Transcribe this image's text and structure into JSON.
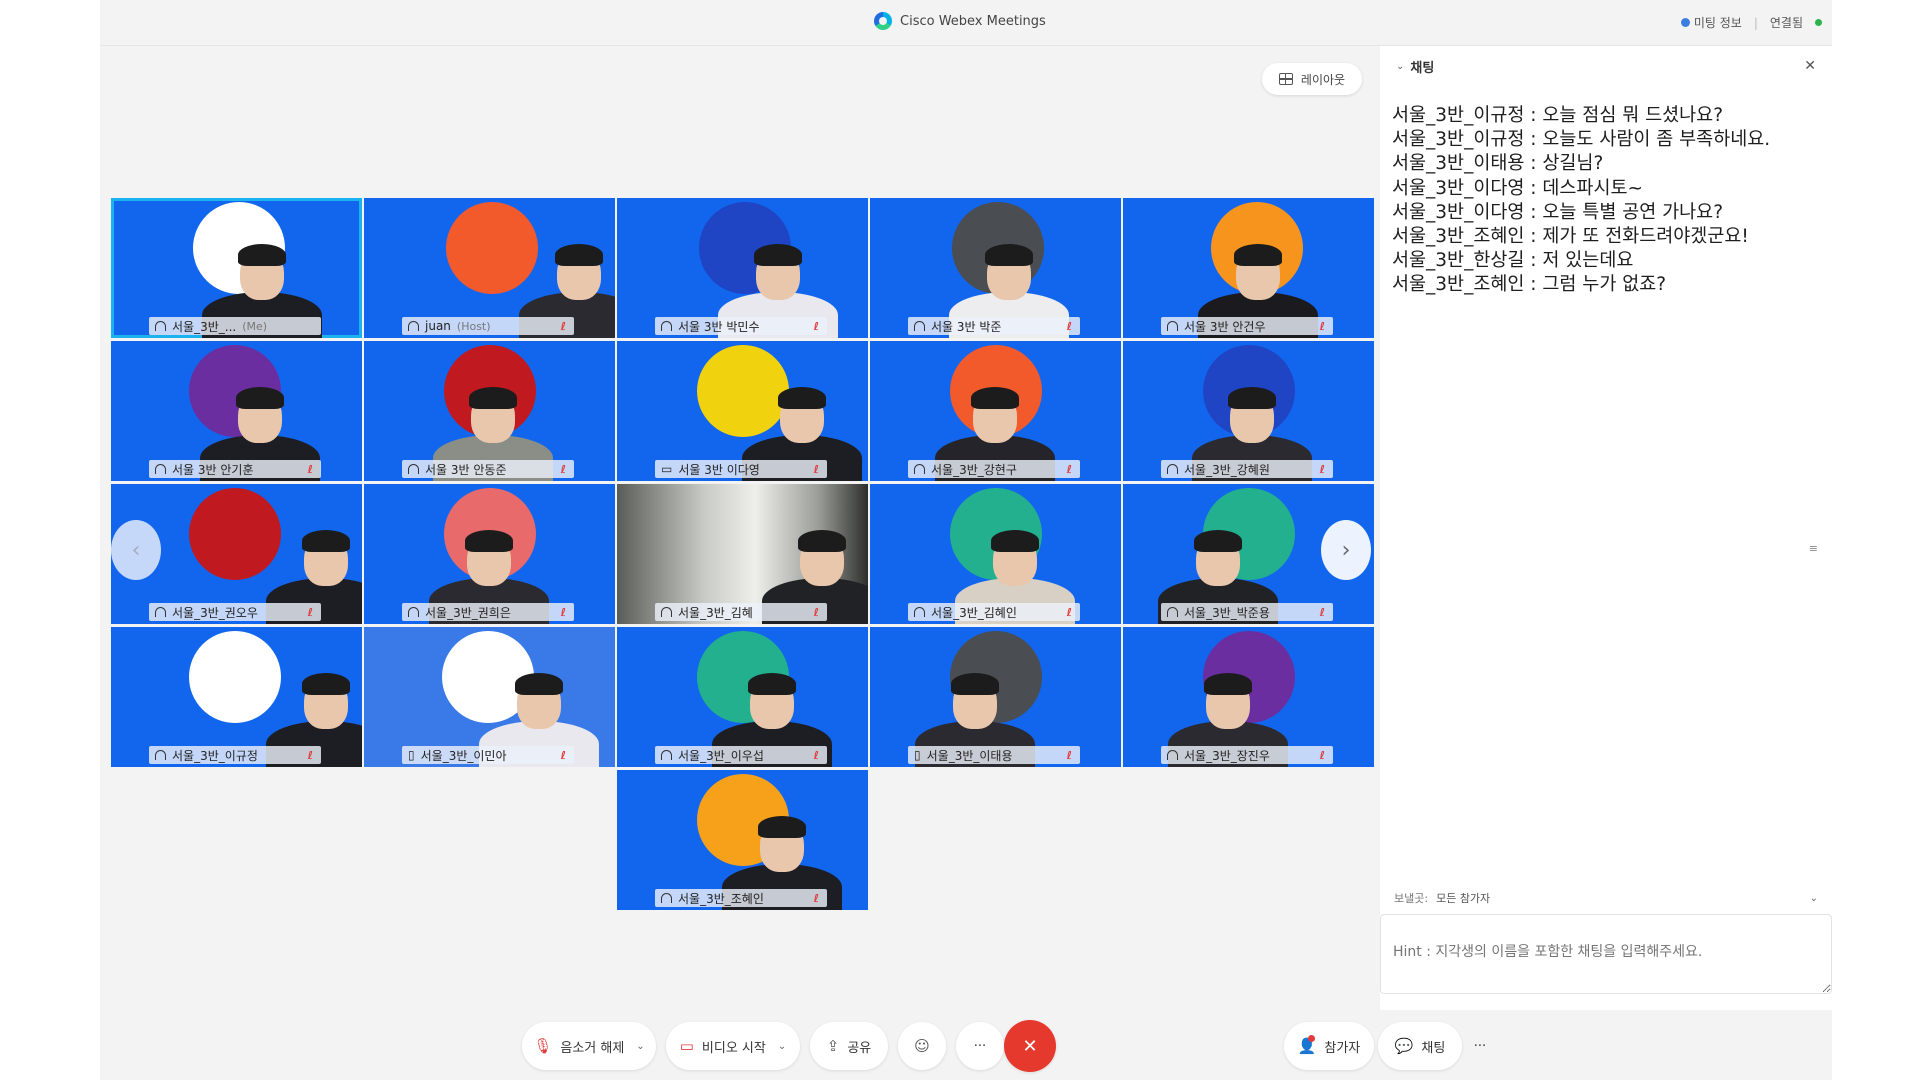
{
  "titlebar": {
    "title": "Cisco Webex Meetings",
    "meeting_info": "미팅 정보",
    "connection": "연결됨"
  },
  "layout_button": {
    "label": "레이아웃"
  },
  "participants": [
    {
      "name": "서울_3반_...",
      "tag": "(Me)",
      "circle": "#ffffff",
      "shirt": "#1d1d24",
      "icon": "headset"
    },
    {
      "name": "juan",
      "tag": "(Host)",
      "circle": "#f25a2c",
      "shirt": "#2a2a30",
      "icon": "headset"
    },
    {
      "name": "서울 3반 박민수",
      "tag": "",
      "circle": "#1f44c4",
      "shirt": "#e8e8ee",
      "icon": "headset"
    },
    {
      "name": "서울 3반 박준",
      "tag": "",
      "circle": "#4a4d52",
      "shirt": "#ededf0",
      "icon": "headset"
    },
    {
      "name": "서울 3반 안건우",
      "tag": "",
      "circle": "#f7941d",
      "shirt": "#1a1a1f",
      "icon": "headset"
    },
    {
      "name": "서울 3반 안기훈",
      "tag": "",
      "circle": "#6a2ea0",
      "shirt": "#1d1d24",
      "icon": "headset"
    },
    {
      "name": "서울 3반 안동준",
      "tag": "",
      "circle": "#c0191f",
      "shirt": "#8a8e86",
      "icon": "headset"
    },
    {
      "name": "서울 3반 이다영",
      "tag": "",
      "circle": "#f0d20f",
      "shirt": "#1d1d24",
      "icon": "screen"
    },
    {
      "name": "서울_3반_강현구",
      "tag": "",
      "circle": "#f25a2c",
      "shirt": "#24242a",
      "icon": "headset"
    },
    {
      "name": "서울_3반_강혜원",
      "tag": "",
      "circle": "#1f44c4",
      "shirt": "#2a2a30",
      "icon": "headset"
    },
    {
      "name": "서울_3반_권오우",
      "tag": "",
      "circle": "#c0191f",
      "shirt": "#1d1d24",
      "icon": "headset"
    },
    {
      "name": "서울_3반_권희은",
      "tag": "",
      "circle": "#e86a6a",
      "shirt": "#2a2a30",
      "icon": "headset"
    },
    {
      "name": "서울_3반_김혜",
      "tag": "",
      "circle": "",
      "shirt": "#202225",
      "icon": "headset"
    },
    {
      "name": "서울_3반_김혜인",
      "tag": "",
      "circle": "#22b08e",
      "shirt": "#d8d0c4",
      "icon": "headset"
    },
    {
      "name": "서울_3반_박준용",
      "tag": "",
      "circle": "#22b08e",
      "shirt": "#202225",
      "icon": "headset"
    },
    {
      "name": "서울_3반_이규정",
      "tag": "",
      "circle": "#ffffff",
      "shirt": "#1d1d24",
      "icon": "headset"
    },
    {
      "name": "서울_3반_이민아",
      "tag": "",
      "circle": "#ffffff",
      "shirt": "#e8e8ee",
      "icon": "phone"
    },
    {
      "name": "서울_3반_이우섭",
      "tag": "",
      "circle": "#22b08e",
      "shirt": "#1d1d24",
      "icon": "headset"
    },
    {
      "name": "서울_3반_이태용",
      "tag": "",
      "circle": "#4a4d52",
      "shirt": "#2a2a30",
      "icon": "phone"
    },
    {
      "name": "서울_3반_장진우",
      "tag": "",
      "circle": "#6a2ea0",
      "shirt": "#2a2a30",
      "icon": "headset"
    },
    {
      "name": "서울_3반_조혜인",
      "tag": "",
      "circle": "#f7a11a",
      "shirt": "#1d1d24",
      "icon": "headset"
    }
  ],
  "chat": {
    "title": "채팅",
    "messages": [
      "서울_3반_이규정 : 오늘 점심 뭐 드셨나요?",
      "서울_3반_이규정 : 오늘도 사람이 좀 부족하네요.",
      "서울_3반_이태용 : 상길님?",
      "서울_3반_이다영 : 데스파시토~",
      "서울_3반_이다영 : 오늘 특별 공연 가나요?",
      "서울_3반_조혜인 : 제가 또 전화드려야겠군요!",
      "서울_3반_한상길 : 저 있는데요",
      "서울_3반_조혜인 : 그럼 누가 없죠?"
    ],
    "recipient_label": "보낼곳:",
    "recipient_value": "모든 참가자",
    "input_placeholder": "Hint : 지각생의 이름을 포함한 채팅을 입력해주세요."
  },
  "toolbar": {
    "mute": "음소거 해제",
    "video": "비디오 시작",
    "share": "공유",
    "participants": "참가자",
    "chat": "채팅",
    "more": "···"
  }
}
